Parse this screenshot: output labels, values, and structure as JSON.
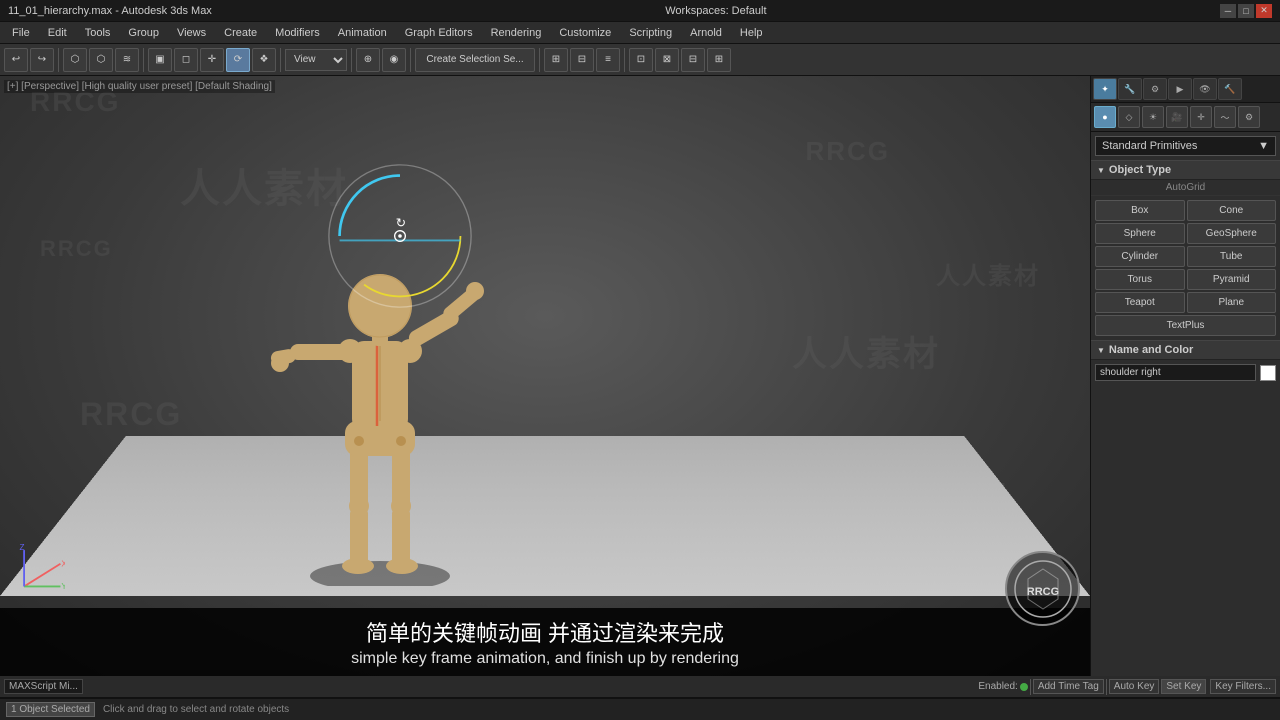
{
  "app": {
    "title": "11_01_hierarchy.max - Autodesk 3ds Max",
    "workspace_label": "Workspaces: Default"
  },
  "menu": {
    "items": [
      "File",
      "Edit",
      "Tools",
      "Group",
      "Views",
      "Create",
      "Modifiers",
      "Animation",
      "Graph Editors",
      "Rendering",
      "Customize",
      "Scripting",
      "Arnold",
      "Help"
    ]
  },
  "toolbar": {
    "items": [
      "↩",
      "↪",
      "⬡",
      "⬡",
      "≋",
      "▣",
      "✛",
      "⟳",
      "◻",
      "❖",
      "View",
      "⊕",
      "◉",
      "Create Selection Se...",
      "⊞",
      "⊟",
      "⊠",
      "⊡",
      "⊞⊡",
      "⊟⊡",
      "⊠⊡",
      "K",
      "☰",
      "⊗"
    ]
  },
  "viewport": {
    "label": "[+] [Perspective] [High quality user preset] [Default Shading]"
  },
  "right_panel": {
    "dropdown_label": "Standard Primitives",
    "object_type_header": "Object Type",
    "autogrid_label": "AutoGrid",
    "primitives": [
      {
        "label": "Box"
      },
      {
        "label": "Cone"
      },
      {
        "label": "Sphere"
      },
      {
        "label": "GeoSphere"
      },
      {
        "label": "Cylinder"
      },
      {
        "label": "Tube"
      },
      {
        "label": "Torus"
      },
      {
        "label": "Pyramid"
      },
      {
        "label": "Teapot"
      },
      {
        "label": "Plane"
      },
      {
        "label": "TextPlus"
      }
    ],
    "name_color_header": "Name and Color",
    "object_name": "shoulder right"
  },
  "status_bar": {
    "selection": "1 Object Selected",
    "hint": "Click and drag to select and rotate objects",
    "enabled_label": "Enabled:",
    "time_tag": "Add Time Tag",
    "key_filters": "Key Filters..."
  },
  "subtitles": {
    "chinese": "简单的关键帧动画 并通过渲染来完成",
    "english": "simple key frame animation, and finish up by rendering"
  },
  "watermarks": [
    "RRCG",
    "人人素材",
    "RRCG",
    "人人素材",
    "RRCG",
    "人人素材",
    "RRCG",
    "人人素材"
  ]
}
